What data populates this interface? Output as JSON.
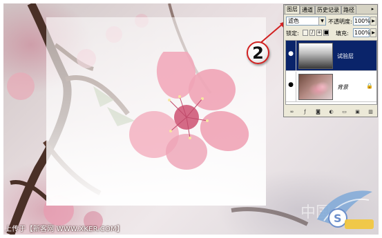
{
  "panel": {
    "tabs": [
      {
        "label": "图层",
        "active": true
      },
      {
        "label": "通道",
        "active": false
      },
      {
        "label": "历史记录",
        "active": false
      },
      {
        "label": "路径",
        "active": false
      }
    ],
    "menu_icon": "panel-menu-icon",
    "blend_mode": "滤色",
    "opacity_label": "不透明度:",
    "opacity_value": "100%",
    "lock_label": "锁定:",
    "fill_label": "填充:",
    "fill_value": "100%",
    "layers": [
      {
        "name": "试验层",
        "selected": true,
        "visible": true
      },
      {
        "name": "背景",
        "selected": false,
        "visible": true,
        "locked": true
      }
    ],
    "footer_icons": [
      "link-icon",
      "fx-icon",
      "mask-icon",
      "adjustment-icon",
      "group-icon",
      "new-layer-icon",
      "trash-icon"
    ]
  },
  "callout": {
    "number": "2",
    "color": "#d22020"
  },
  "canvas": {
    "upload_caption": "上传于【新客网 WWW.XKER.COM】",
    "watermark_text": "中国",
    "watermark_logo": "shield-wing-logo"
  },
  "colors": {
    "panel_bg": "#ece9d8",
    "selected_layer": "#0a246a",
    "blossom": "#f2aabb"
  }
}
